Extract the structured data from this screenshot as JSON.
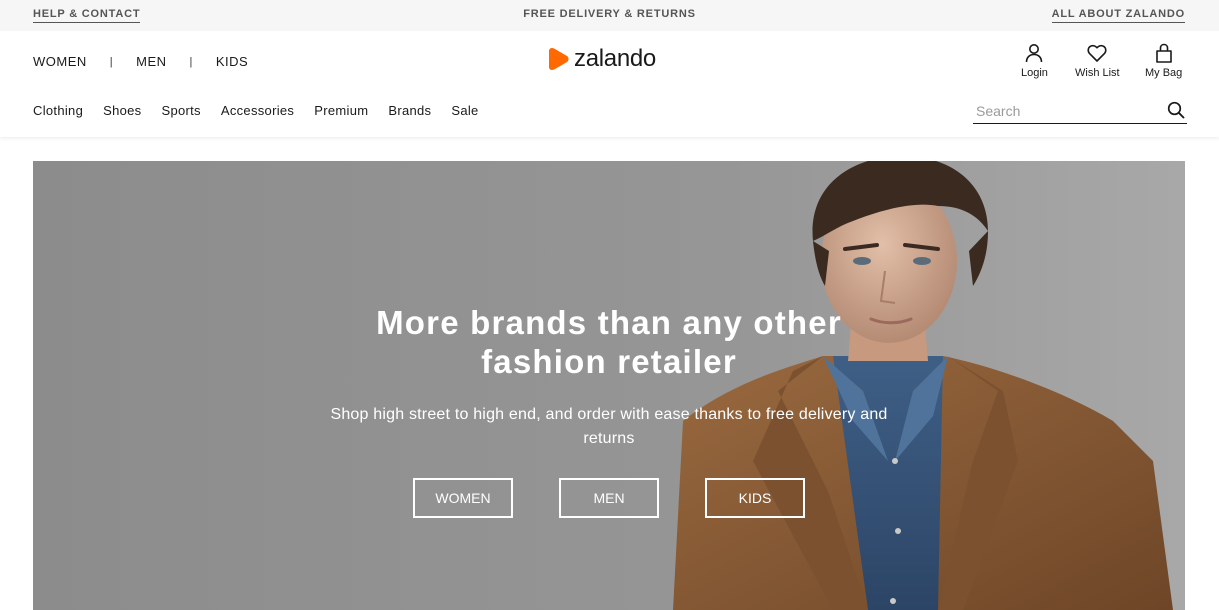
{
  "topbar": {
    "help": "HELP & CONTACT",
    "delivery": "FREE DELIVERY & RETURNS",
    "about": "ALL ABOUT ZALANDO"
  },
  "header": {
    "gender_nav": [
      "WOMEN",
      "MEN",
      "KIDS"
    ],
    "logo_text": "zalando",
    "brand_color": "#ff6900",
    "account": {
      "login": "Login",
      "wishlist": "Wish List",
      "bag": "My Bag"
    },
    "categories": [
      "Clothing",
      "Shoes",
      "Sports",
      "Accessories",
      "Premium",
      "Brands",
      "Sale"
    ],
    "search": {
      "placeholder": "Search",
      "value": ""
    }
  },
  "hero": {
    "title_line1": "More brands than any other",
    "title_line2": "fashion retailer",
    "subtitle_line1": "Shop high street to high end, and order with ease thanks to free delivery and",
    "subtitle_line2": "returns",
    "buttons": [
      "WOMEN",
      "MEN",
      "KIDS"
    ]
  },
  "icons": {
    "logo": "zalando-logo-icon",
    "login": "user-icon",
    "wishlist": "heart-icon",
    "bag": "shopping-bag-icon",
    "search": "search-icon"
  }
}
